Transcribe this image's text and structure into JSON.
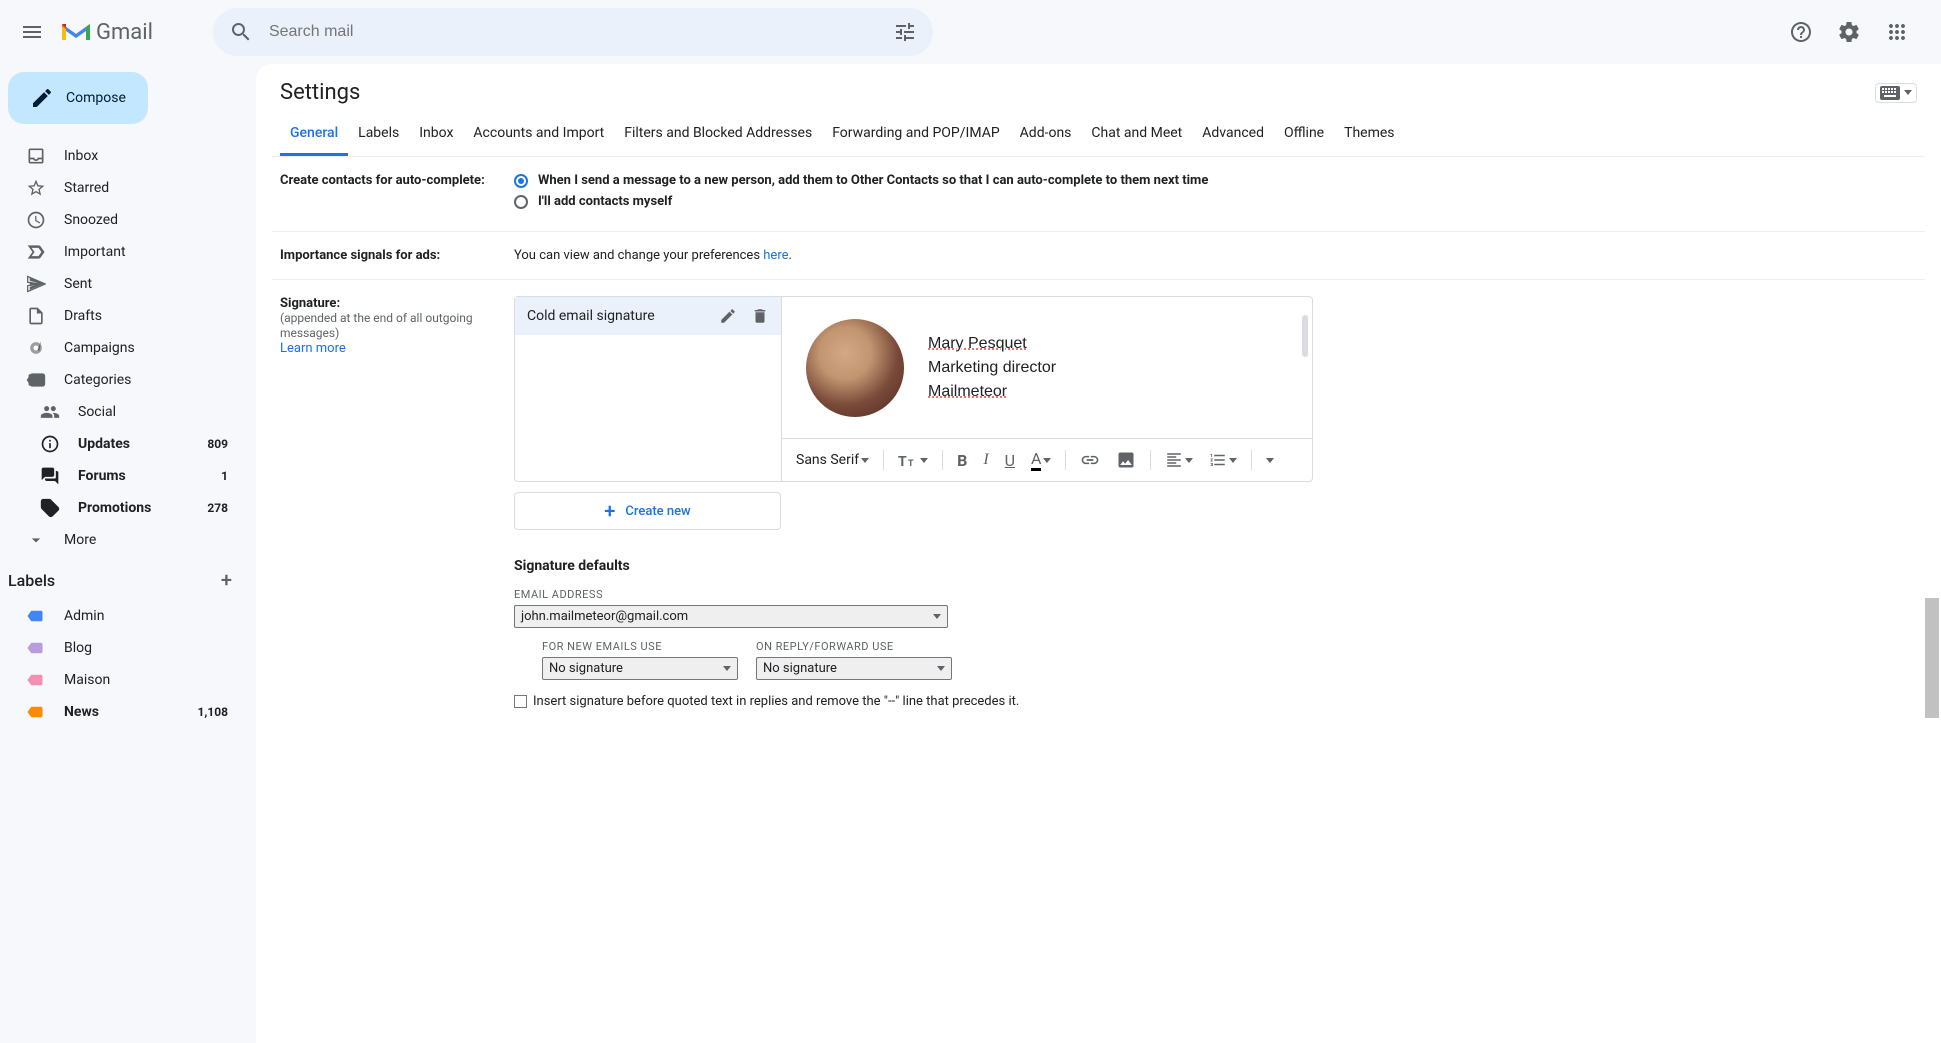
{
  "header": {
    "logo_text": "Gmail",
    "search_placeholder": "Search mail"
  },
  "compose_label": "Compose",
  "nav": [
    {
      "label": "Inbox",
      "count": ""
    },
    {
      "label": "Starred",
      "count": ""
    },
    {
      "label": "Snoozed",
      "count": ""
    },
    {
      "label": "Important",
      "count": ""
    },
    {
      "label": "Sent",
      "count": ""
    },
    {
      "label": "Drafts",
      "count": ""
    },
    {
      "label": "Campaigns",
      "count": ""
    },
    {
      "label": "Categories",
      "count": ""
    },
    {
      "label": "Social",
      "count": "",
      "sub": true
    },
    {
      "label": "Updates",
      "count": "809",
      "bold": true,
      "sub": true
    },
    {
      "label": "Forums",
      "count": "1",
      "bold": true,
      "sub": true
    },
    {
      "label": "Promotions",
      "count": "278",
      "bold": true,
      "sub": true
    },
    {
      "label": "More",
      "count": ""
    }
  ],
  "labels_header": "Labels",
  "labels": [
    {
      "label": "Admin",
      "color": "#4285f4"
    },
    {
      "label": "Blog",
      "color": "#b39ddb"
    },
    {
      "label": "Maison",
      "color": "#f48fb1"
    },
    {
      "label": "News",
      "color": "#fb8c00",
      "count": "1,108",
      "bold": true
    }
  ],
  "settings_title": "Settings",
  "tabs": [
    "General",
    "Labels",
    "Inbox",
    "Accounts and Import",
    "Filters and Blocked Addresses",
    "Forwarding and POP/IMAP",
    "Add-ons",
    "Chat and Meet",
    "Advanced",
    "Offline",
    "Themes"
  ],
  "row_contacts": {
    "label": "Create contacts for auto-complete:",
    "opt1": "When I send a message to a new person, add them to Other Contacts so that I can auto-complete to them next time",
    "opt2": "I'll add contacts myself"
  },
  "row_ads": {
    "label": "Importance signals for ads:",
    "text": "You can view and change your preferences ",
    "link": "here",
    "after": "."
  },
  "row_sig": {
    "label": "Signature:",
    "sub": "(appended at the end of all outgoing messages)",
    "learn": "Learn more",
    "sig_name": "Cold email signature",
    "preview_name": "Mary Pesquet",
    "preview_title": "Marketing director",
    "preview_company": "Mailmeteor",
    "font": "Sans Serif",
    "create_new": "Create new"
  },
  "defaults": {
    "header": "Signature defaults",
    "email_label": "EMAIL ADDRESS",
    "email_value": "john.mailmeteor@gmail.com",
    "new_label": "FOR NEW EMAILS USE",
    "new_value": "No signature",
    "reply_label": "ON REPLY/FORWARD USE",
    "reply_value": "No signature",
    "checkbox_text": "Insert signature before quoted text in replies and remove the \"--\" line that precedes it."
  }
}
